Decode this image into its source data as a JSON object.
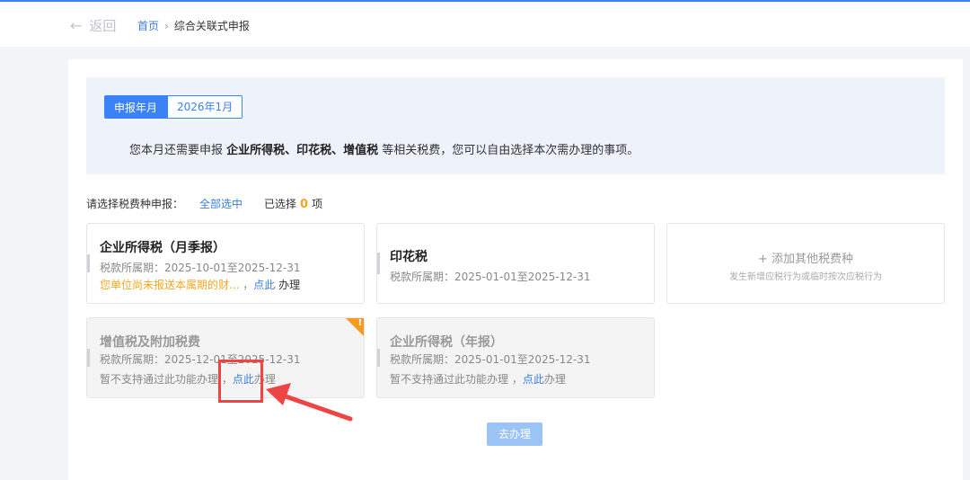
{
  "header": {
    "back_label": "返回",
    "breadcrumb_home": "首页",
    "breadcrumb_sep": "›",
    "breadcrumb_current": "综合关联式申报"
  },
  "info": {
    "month_label": "申报年月",
    "month_value": "2026年1月",
    "notice_prefix": "您本月还需要申报 ",
    "notice_taxes": "企业所得税、印花税、增值税",
    "notice_suffix": " 等相关税费，您可以自由选择本次需办理的事项。"
  },
  "selection": {
    "prompt": "请选择税费种申报：",
    "select_all": "全部选中",
    "chosen_prefix": "已选择",
    "chosen_count": "0",
    "chosen_suffix": "项"
  },
  "cards": [
    {
      "title": "企业所得税（月季报）",
      "period": "税款所属期：2025-10-01至2025-12-31",
      "warning": "您单位尚未报送本属期的财...",
      "sep": " ，",
      "link": "点此",
      "op": " 办理",
      "disabled": false
    },
    {
      "title": "印花税",
      "period": "税款所属期：2025-01-01至2025-12-31",
      "disabled": false
    },
    {
      "title": "增值税及附加税费",
      "period": "税款所属期：2025-12-01至2025-12-31",
      "note": "暂不支持通过此功能办理 ，",
      "link": "点此",
      "op": "办理",
      "badge": "!",
      "disabled": true
    },
    {
      "title": "企业所得税（年报）",
      "period": "税款所属期：2025-01-01至2025-12-31",
      "note": "暂不支持通过此功能办理 ，",
      "link": "点此",
      "op": "办理",
      "disabled": true
    }
  ],
  "add_card": {
    "icon": "plus-icon",
    "plus": "+",
    "title": "添加其他税费种",
    "subtitle": "发生新增应税行为或临时按次应税行为"
  },
  "go_button": "去办理",
  "colors": {
    "primary": "#3b82f6",
    "link": "#3b7ddd",
    "warning": "#f5a623",
    "annotation": "#ef4444"
  }
}
